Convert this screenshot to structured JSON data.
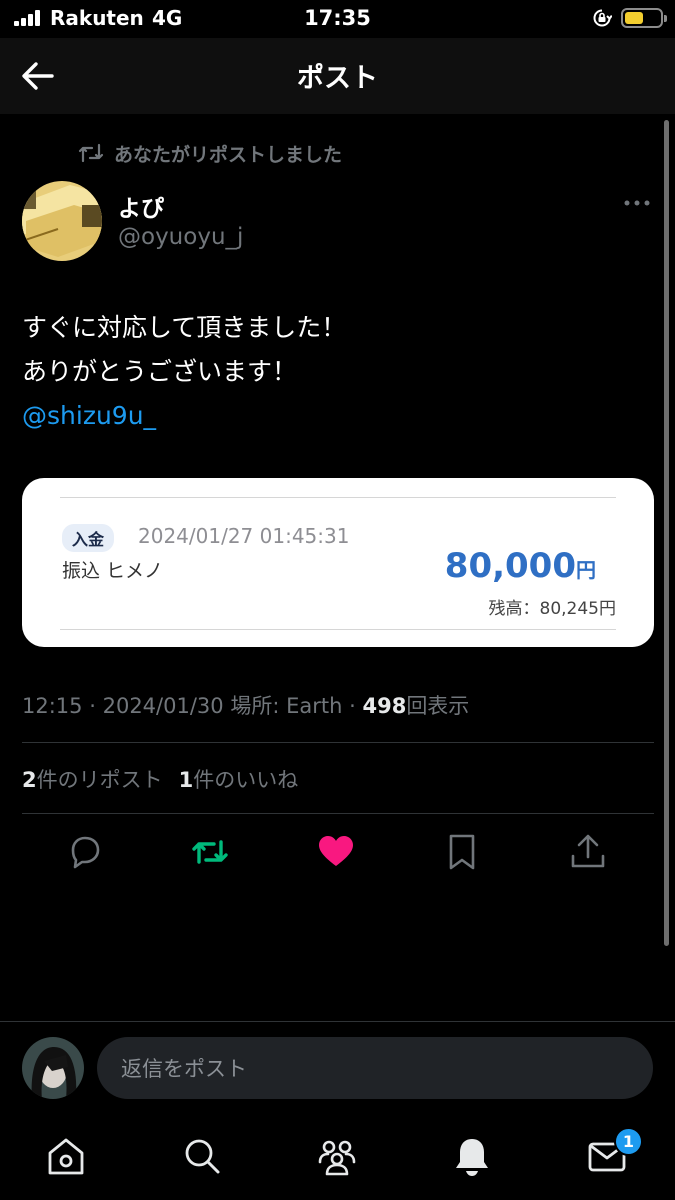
{
  "status_bar": {
    "carrier": "Rakuten",
    "network": "4G",
    "time": "17:35"
  },
  "header": {
    "title": "ポスト"
  },
  "post": {
    "repost_context": "あなたがリポストしました",
    "author": {
      "display_name": "よぴ",
      "handle": "@oyuoyu_j"
    },
    "text_lines": [
      "すぐに対応して頂きました！",
      "ありがとうございます！"
    ],
    "mention": "@shizu9u_",
    "image": {
      "badge": "入金",
      "datetime": "2024/01/27 01:45:31",
      "description": "振込 ヒメノ",
      "amount": "80,000",
      "amount_unit": "円",
      "balance": "残高：80,245円"
    },
    "meta": {
      "time": "12:15",
      "separator": "·",
      "date": "2024/01/30",
      "location": "場所: Earth",
      "views": "498",
      "views_label": "回表示"
    },
    "stats": {
      "reposts_count": "2",
      "reposts_label": "件のリポスト",
      "likes_count": "1",
      "likes_label": "件のいいね"
    },
    "actions": [
      "reply-icon",
      "repost-icon",
      "like-icon",
      "bookmark-icon",
      "share-icon"
    ]
  },
  "reply_bar": {
    "placeholder": "返信をポスト"
  },
  "tab_bar": {
    "tabs": [
      "home-icon",
      "search-icon",
      "communities-icon",
      "notifications-icon",
      "messages-icon"
    ],
    "messages_badge": "1"
  },
  "colors": {
    "accent": "#1d9bf0",
    "repost": "#00ba7c",
    "like": "#f91880",
    "muted": "#71767b"
  }
}
